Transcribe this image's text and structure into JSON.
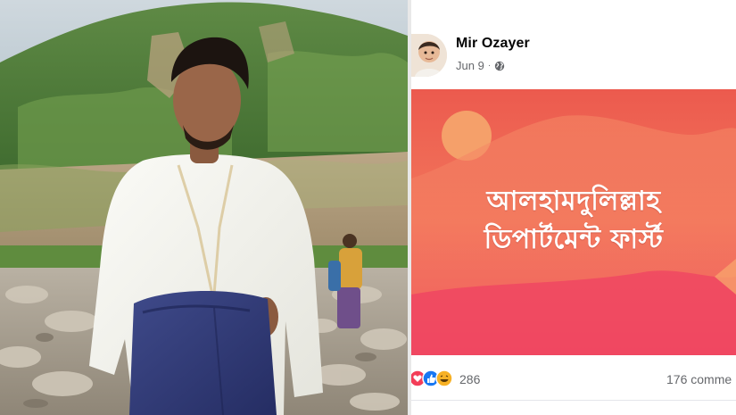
{
  "post": {
    "author": "Mir Ozayer",
    "date": "Jun 9",
    "separator": "·",
    "image_text": {
      "line1": "আলহামদুলিল্লাহ",
      "line2": "ডিপার্টমেন্ট ফার্স্ট"
    },
    "reactions_count": "286",
    "comments_count": "176 comme"
  },
  "colors": {
    "post_bg_top": "#ec5a4e",
    "post_bg_mid": "#f2775c",
    "post_bg_bottom": "#f04a64",
    "sun": "#f5a06a",
    "text_primary": "#050505",
    "text_secondary": "#65676b"
  },
  "icons": {
    "privacy": "globe-icon",
    "reactions": [
      "love-icon",
      "like-icon",
      "haha-icon"
    ]
  }
}
